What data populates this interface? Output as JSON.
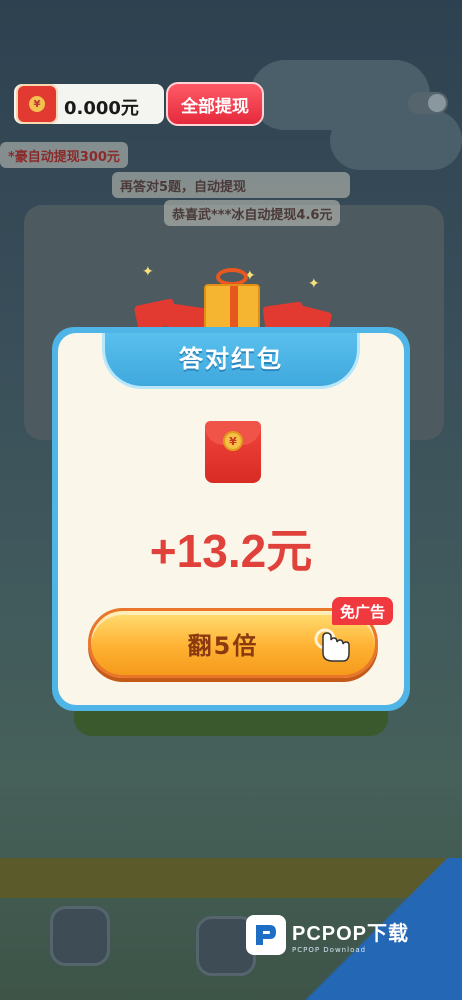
{
  "top_bar": {
    "balance": "0.000元",
    "withdraw_all_label": "全部提现"
  },
  "tickers": [
    "*豪自动提现300元",
    "再答对5题，自动提现",
    "恭喜武***冰自动提现4.6元"
  ],
  "modal": {
    "title": "答对红包",
    "envelope_symbol": "¥",
    "reward_amount": "+13.2元",
    "multiply_label": "翻5倍",
    "ad_free_badge": "免广告"
  },
  "watermark": {
    "name": "PCPOP下载",
    "sub": "PCPOP Download"
  }
}
